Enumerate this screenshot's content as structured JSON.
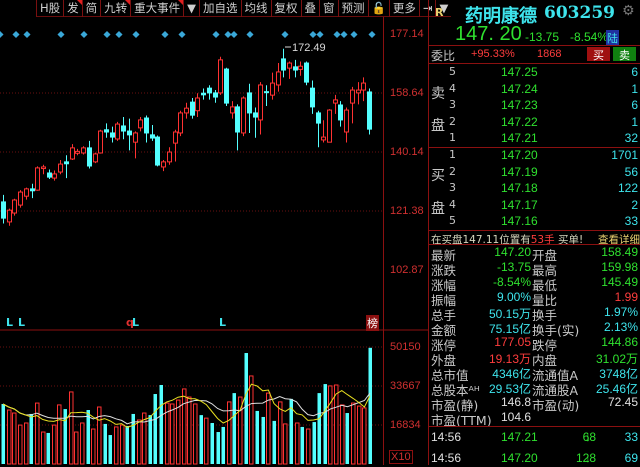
{
  "toolbar": {
    "items": [
      "H股",
      "发",
      "简",
      "九转",
      "重大事件",
      "▼",
      "加自选",
      "均线",
      "复权",
      "叠",
      "窗",
      "预测",
      "🔓",
      "更多",
      "⇥",
      "▼"
    ]
  },
  "chart": {
    "high_label": "172.49",
    "price_axis": [
      "177.14",
      "158.64",
      "140.14",
      "121.38",
      "102.87"
    ],
    "volume_axis": [
      "50150",
      "33667",
      "16834"
    ],
    "volume_unit": "X10",
    "markers": [
      {
        "text": "L",
        "color": "#3ee4ec"
      },
      {
        "text": "L",
        "color": "#3ee4ec"
      },
      {
        "text": "q",
        "color": "#e03030"
      },
      {
        "text": "L",
        "color": "#3ee4ec"
      },
      {
        "text": "L",
        "color": "#3ee4ec"
      }
    ],
    "rank_badge": "榜"
  },
  "chart_data": {
    "type": "candlestick",
    "price_range": [
      102.87,
      177.14
    ],
    "ohlc": [
      [
        124.3,
        126.5,
        117.5,
        119.2
      ],
      [
        118.0,
        122.2,
        116.8,
        121.7
      ],
      [
        120.8,
        125.3,
        120.0,
        124.9
      ],
      [
        123.3,
        128.0,
        122.5,
        127.4
      ],
      [
        126.1,
        128.8,
        125.0,
        128.4
      ],
      [
        128.4,
        130.0,
        125.5,
        127.8
      ],
      [
        128.0,
        135.5,
        127.8,
        135.0
      ],
      [
        134.8,
        136.0,
        133.0,
        135.3
      ],
      [
        133.4,
        134.5,
        131.5,
        132.1
      ],
      [
        131.8,
        134.2,
        131.0,
        133.1
      ],
      [
        133.7,
        137.5,
        133.0,
        136.2
      ],
      [
        136.9,
        139.0,
        131.8,
        136.3
      ],
      [
        137.8,
        142.5,
        137.5,
        141.3
      ],
      [
        139.6,
        141.0,
        139.0,
        140.2
      ],
      [
        139.7,
        141.8,
        139.2,
        141.3
      ],
      [
        141.3,
        143.5,
        134.8,
        135.6
      ],
      [
        136.9,
        139.8,
        136.5,
        139.4
      ],
      [
        139.7,
        147.0,
        139.5,
        146.6
      ],
      [
        147.0,
        149.0,
        144.5,
        146.3
      ],
      [
        146.0,
        148.0,
        143.0,
        144.7
      ],
      [
        144.1,
        149.5,
        143.5,
        148.8
      ],
      [
        148.2,
        151.0,
        144.0,
        146.6
      ],
      [
        146.6,
        150.5,
        140.5,
        145.4
      ],
      [
        143.1,
        146.5,
        138.0,
        146.0
      ],
      [
        147.6,
        151.0,
        146.5,
        150.1
      ],
      [
        150.7,
        151.5,
        143.0,
        146.0
      ],
      [
        145.4,
        148.5,
        143.5,
        144.4
      ],
      [
        144.7,
        145.2,
        135.5,
        135.9
      ],
      [
        135.3,
        137.5,
        134.0,
        136.9
      ],
      [
        136.9,
        141.5,
        136.0,
        140.0
      ],
      [
        142.8,
        147.0,
        137.0,
        146.3
      ],
      [
        146.0,
        153.0,
        145.0,
        152.3
      ],
      [
        152.3,
        155.5,
        150.5,
        153.8
      ],
      [
        155.7,
        157.0,
        150.5,
        151.6
      ],
      [
        153.0,
        158.5,
        151.0,
        157.0
      ],
      [
        158.5,
        160.0,
        156.5,
        158.0
      ],
      [
        160.1,
        161.0,
        156.5,
        158.6
      ],
      [
        158.6,
        159.5,
        155.5,
        157.3
      ],
      [
        158.6,
        170.0,
        158.0,
        169.0
      ],
      [
        166.1,
        166.5,
        154.5,
        155.4
      ],
      [
        152.3,
        156.0,
        150.5,
        154.2
      ],
      [
        154.2,
        155.0,
        140.5,
        146.3
      ],
      [
        146.0,
        157.5,
        145.0,
        157.0
      ],
      [
        158.6,
        161.5,
        146.0,
        152.3
      ],
      [
        152.3,
        154.0,
        144.5,
        151.0
      ],
      [
        150.1,
        162.0,
        145.5,
        161.1
      ],
      [
        159.0,
        161.0,
        154.5,
        158.9
      ],
      [
        157.9,
        165.0,
        156.5,
        161.7
      ],
      [
        161.1,
        168.0,
        159.0,
        165.2
      ],
      [
        169.3,
        172.49,
        163.5,
        165.8
      ],
      [
        166.4,
        168.5,
        163.0,
        168.0
      ],
      [
        166.8,
        169.0,
        163.5,
        165.8
      ],
      [
        166.0,
        168.5,
        164.0,
        167.0
      ],
      [
        168.0,
        168.5,
        161.0,
        162.0
      ],
      [
        160.1,
        162.5,
        152.0,
        154.2
      ],
      [
        152.3,
        153.0,
        141.5,
        149.1
      ],
      [
        143.8,
        150.0,
        143.0,
        144.7
      ],
      [
        143.1,
        153.5,
        143.0,
        153.2
      ],
      [
        155.4,
        158.0,
        152.0,
        156.4
      ],
      [
        154.8,
        156.0,
        148.0,
        150.1
      ],
      [
        146.3,
        154.0,
        143.0,
        153.2
      ],
      [
        155.4,
        160.5,
        149.0,
        159.5
      ],
      [
        158.6,
        162.0,
        155.0,
        159.5
      ],
      [
        159.5,
        163.5,
        156.0,
        161.7
      ],
      [
        158.9,
        160.0,
        145.5,
        147.2
      ]
    ],
    "volume": [
      [
        25900,
        0
      ],
      [
        23300,
        1
      ],
      [
        22000,
        1
      ],
      [
        16800,
        1
      ],
      [
        17700,
        1
      ],
      [
        21600,
        0
      ],
      [
        26300,
        1
      ],
      [
        13800,
        1
      ],
      [
        13400,
        0
      ],
      [
        16800,
        1
      ],
      [
        25500,
        1
      ],
      [
        23700,
        0
      ],
      [
        31100,
        1
      ],
      [
        13800,
        1
      ],
      [
        17700,
        1
      ],
      [
        23300,
        0
      ],
      [
        15100,
        1
      ],
      [
        24600,
        1
      ],
      [
        17300,
        0
      ],
      [
        12500,
        0
      ],
      [
        16000,
        1
      ],
      [
        16800,
        1
      ],
      [
        16400,
        0
      ],
      [
        21600,
        0
      ],
      [
        19000,
        1
      ],
      [
        22000,
        1
      ],
      [
        21100,
        0
      ],
      [
        30200,
        0
      ],
      [
        34100,
        0
      ],
      [
        26300,
        1
      ],
      [
        25900,
        1
      ],
      [
        27600,
        1
      ],
      [
        32400,
        1
      ],
      [
        28900,
        1
      ],
      [
        25900,
        1
      ],
      [
        21100,
        0
      ],
      [
        19800,
        1
      ],
      [
        17700,
        0
      ],
      [
        13800,
        0
      ],
      [
        16000,
        0
      ],
      [
        26800,
        1
      ],
      [
        30600,
        0
      ],
      [
        28900,
        1
      ],
      [
        47900,
        0
      ],
      [
        38000,
        1
      ],
      [
        22900,
        0
      ],
      [
        20300,
        0
      ],
      [
        30600,
        1
      ],
      [
        18600,
        0
      ],
      [
        26800,
        1
      ],
      [
        17300,
        1
      ],
      [
        28100,
        0
      ],
      [
        17700,
        1
      ],
      [
        16000,
        0
      ],
      [
        15100,
        1
      ],
      [
        18100,
        0
      ],
      [
        30600,
        0
      ],
      [
        34500,
        0
      ],
      [
        33700,
        1
      ],
      [
        34100,
        1
      ],
      [
        25500,
        1
      ],
      [
        22000,
        0
      ],
      [
        26300,
        1
      ],
      [
        25000,
        1
      ],
      [
        24200,
        1
      ],
      [
        50150,
        0
      ]
    ],
    "volume_range": [
      0,
      50150
    ],
    "ma_colors": {
      "ma5": "#e8e020",
      "ma10": "#e0e0e0"
    },
    "colors": {
      "up": "#ff3232",
      "down": "#54ffff"
    }
  },
  "quote": {
    "badge": "R",
    "name": "药明康德",
    "code": "603259",
    "price": "147. 20",
    "change": "-13.75",
    "change_pct": "-8.54%",
    "market": "陆",
    "weibi_label": "委比",
    "weibi": "+95.33%",
    "weicha": "1868",
    "buy_btn": "买",
    "sell_btn": "卖",
    "sell_label": [
      "卖",
      "盘"
    ],
    "buy_label": [
      "买",
      "盘"
    ],
    "asks": [
      {
        "lvl": "5",
        "price": "147.25",
        "vol": "6"
      },
      {
        "lvl": "4",
        "price": "147.24",
        "vol": "1"
      },
      {
        "lvl": "3",
        "price": "147.23",
        "vol": "6"
      },
      {
        "lvl": "2",
        "price": "147.22",
        "vol": "1"
      },
      {
        "lvl": "1",
        "price": "147.21",
        "vol": "32"
      }
    ],
    "bids": [
      {
        "lvl": "1",
        "price": "147.20",
        "vol": "1701"
      },
      {
        "lvl": "2",
        "price": "147.19",
        "vol": "56"
      },
      {
        "lvl": "3",
        "price": "147.18",
        "vol": "122"
      },
      {
        "lvl": "4",
        "price": "147.17",
        "vol": "2"
      },
      {
        "lvl": "5",
        "price": "147.16",
        "vol": "33"
      }
    ],
    "notice_a": "在买盘147.11位置有",
    "notice_b": "53手",
    "notice_c": "买单!",
    "detail_link": "查看详细",
    "stats": [
      {
        "l1": "最新",
        "v1": "147.20",
        "c1": "g",
        "l2": "开盘",
        "v2": "158.49",
        "c2": "g"
      },
      {
        "l1": "涨跌",
        "v1": "-13.75",
        "c1": "g",
        "l2": "最高",
        "v2": "159.98",
        "c2": "g"
      },
      {
        "l1": "涨幅",
        "v1": "-8.54%",
        "c1": "g",
        "l2": "最低",
        "v2": "145.49",
        "c2": "g"
      },
      {
        "l1": "振幅",
        "v1": "9.00%",
        "c1": "c",
        "l2": "量比",
        "v2": "1.99",
        "c2": "r"
      },
      {
        "l1": "总手",
        "v1": "50.15万",
        "c1": "c",
        "l2": "换手",
        "v2": "1.97%",
        "c2": "c"
      },
      {
        "l1": "金额",
        "v1": "75.15亿",
        "c1": "c",
        "l2": "换手(实)",
        "v2": "2.13%",
        "c2": "c"
      },
      {
        "l1": "涨停",
        "v1": "177.05",
        "c1": "r",
        "l2": "跌停",
        "v2": "144.86",
        "c2": "g"
      },
      {
        "l1": "外盘",
        "v1": "19.13万",
        "c1": "r",
        "l2": "内盘",
        "v2": "31.02万",
        "c2": "g"
      },
      {
        "l1": "总市值",
        "v1": "4346亿",
        "c1": "c",
        "l2": "流通值A",
        "v2": "3748亿",
        "c2": "c"
      },
      {
        "l1": "总股本ᴬᴴ",
        "v1": "29.53亿",
        "c1": "c",
        "l2": "流通股A",
        "v2": "25.46亿",
        "c2": "c"
      },
      {
        "l1": "市盈(静)",
        "v1": "146.8",
        "c1": "w",
        "l2": "市盈(动)",
        "v2": "72.45",
        "c2": "w"
      },
      {
        "l1": "市盈(TTM)",
        "v1": "104.6",
        "c1": "w",
        "l2": "",
        "v2": "",
        "c2": "w"
      }
    ],
    "ticks": [
      {
        "time": "14:56",
        "price": "147.21",
        "vol": "68",
        "dir": "↓",
        "n": "33"
      },
      {
        "time": "14:56",
        "price": "147.20",
        "vol": "128",
        "dir": "↓",
        "n": "69"
      }
    ]
  }
}
